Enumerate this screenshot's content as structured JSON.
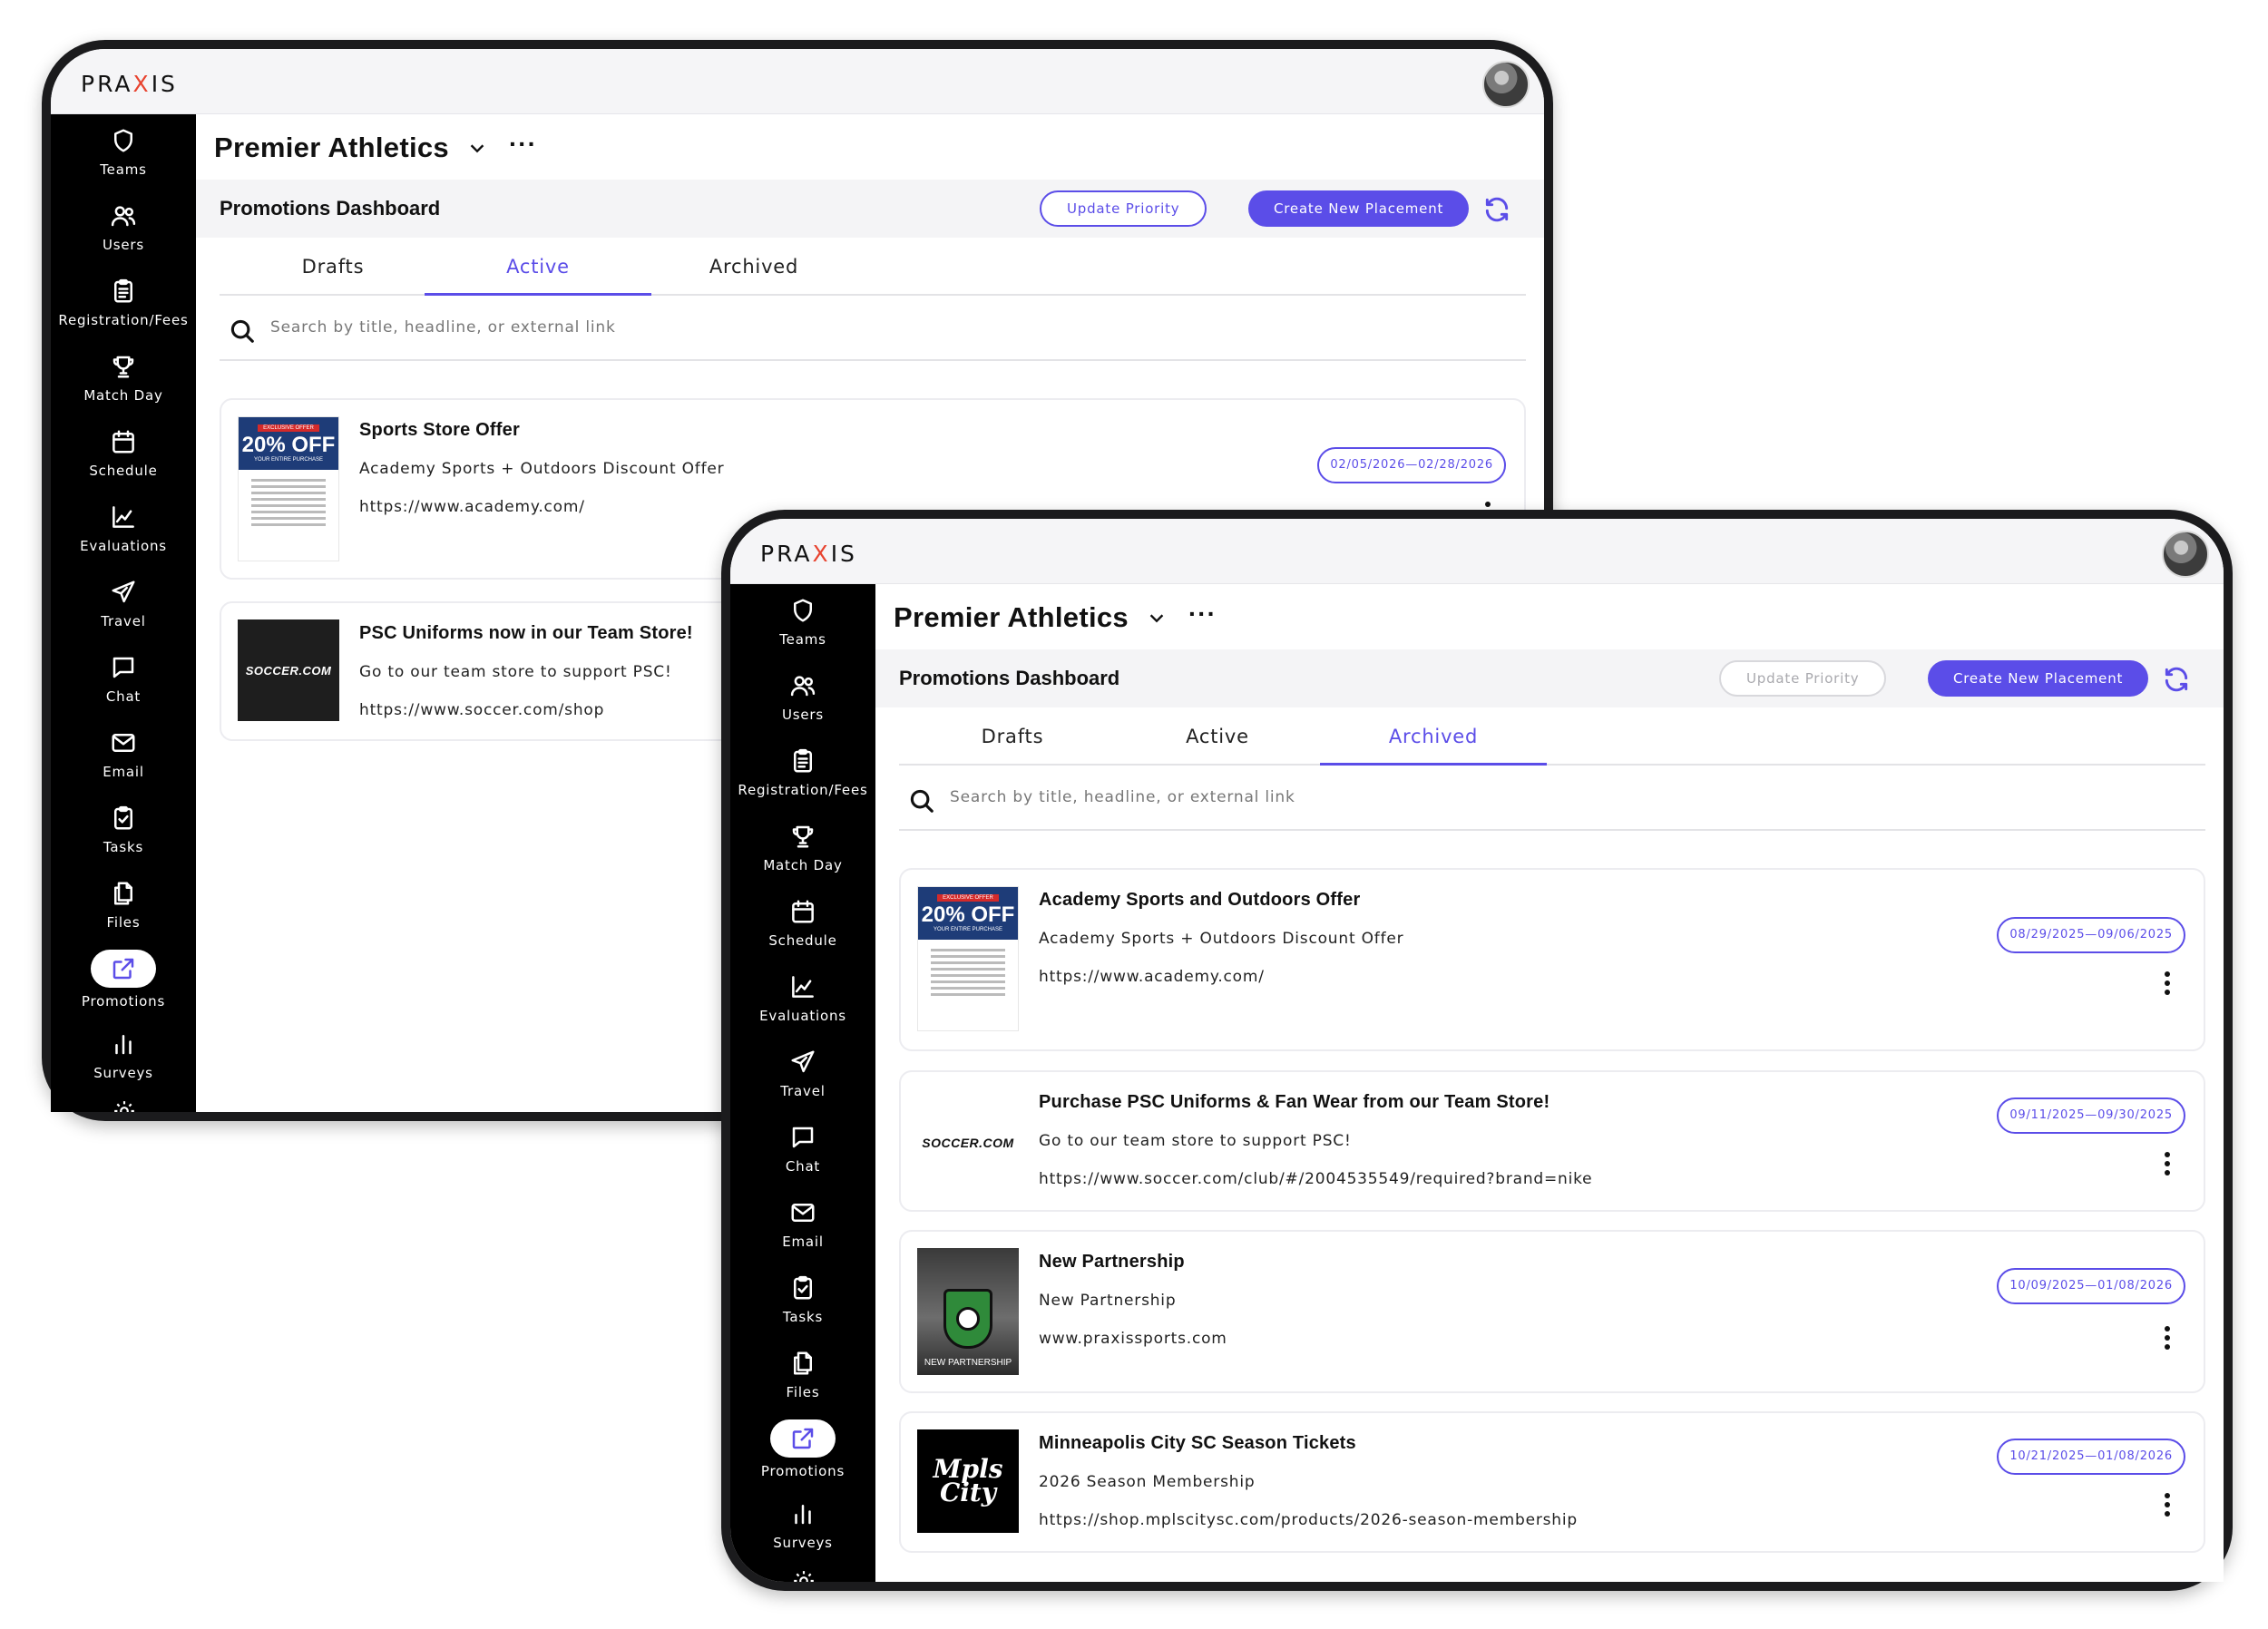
{
  "logo": {
    "pre": "PRA",
    "x": "X",
    "post": "IS"
  },
  "nav": [
    {
      "label": "Teams",
      "icon": "shield-icon"
    },
    {
      "label": "Users",
      "icon": "users-icon"
    },
    {
      "label": "Registration/Fees",
      "icon": "clipboard-icon"
    },
    {
      "label": "Match Day",
      "icon": "trophy-icon"
    },
    {
      "label": "Schedule",
      "icon": "calendar-icon"
    },
    {
      "label": "Evaluations",
      "icon": "line-chart-icon"
    },
    {
      "label": "Travel",
      "icon": "plane-icon"
    },
    {
      "label": "Chat",
      "icon": "chat-icon"
    },
    {
      "label": "Email",
      "icon": "mail-icon"
    },
    {
      "label": "Tasks",
      "icon": "task-icon"
    },
    {
      "label": "Files",
      "icon": "files-icon"
    },
    {
      "label": "Promotions",
      "icon": "external-link-icon"
    },
    {
      "label": "Surveys",
      "icon": "bar-chart-icon"
    }
  ],
  "org_title": "Premier Athletics",
  "dashboard_title": "Promotions Dashboard",
  "buttons": {
    "update_priority": "Update Priority",
    "create_placement": "Create New Placement"
  },
  "tabs": [
    "Drafts",
    "Active",
    "Archived"
  ],
  "search_placeholder": "Search by title, headline, or external link",
  "back_screen": {
    "active_tab": "Active",
    "cards": [
      {
        "title": "Sports Store Offer",
        "headline": "Academy Sports + Outdoors Discount Offer",
        "link": "https://www.academy.com/",
        "dates": "02/05/2026—02/28/2026"
      },
      {
        "title": "PSC Uniforms now in our Team Store!",
        "headline": "Go to our team store to support PSC!",
        "link": "https://www.soccer.com/shop"
      }
    ]
  },
  "front_screen": {
    "active_tab": "Archived",
    "cards": [
      {
        "title": "Academy Sports and Outdoors Offer",
        "headline": "Academy Sports + Outdoors Discount Offer",
        "link": "https://www.academy.com/",
        "dates": "08/29/2025—09/06/2025"
      },
      {
        "title": "Purchase PSC Uniforms & Fan Wear from our Team Store!",
        "headline": "Go to our team store to support PSC!",
        "link": "https://www.soccer.com/club/#/2004535549/required?brand=nike",
        "dates": "09/11/2025—09/30/2025"
      },
      {
        "title": "New Partnership",
        "headline": "New Partnership",
        "link": "www.praxissports.com",
        "dates": "10/09/2025—01/08/2026"
      },
      {
        "title": "Minneapolis City SC Season Tickets",
        "headline": "2026 Season Membership",
        "link": "https://shop.mplscitysc.com/products/2026-season-membership",
        "dates": "10/21/2025—01/08/2026"
      }
    ]
  },
  "thumbs": {
    "academy": {
      "tag": "EXCLUSIVE OFFER",
      "big": "20% OFF",
      "small": "YOUR ENTIRE PURCHASE"
    },
    "soccer": "SOCCER.COM",
    "partner": "NEW PARTNERSHIP",
    "mpls": "Mpls City"
  },
  "colors": {
    "accent": "#5b4de8",
    "sidebar": "#000000",
    "logo_x": "#e8432f"
  }
}
